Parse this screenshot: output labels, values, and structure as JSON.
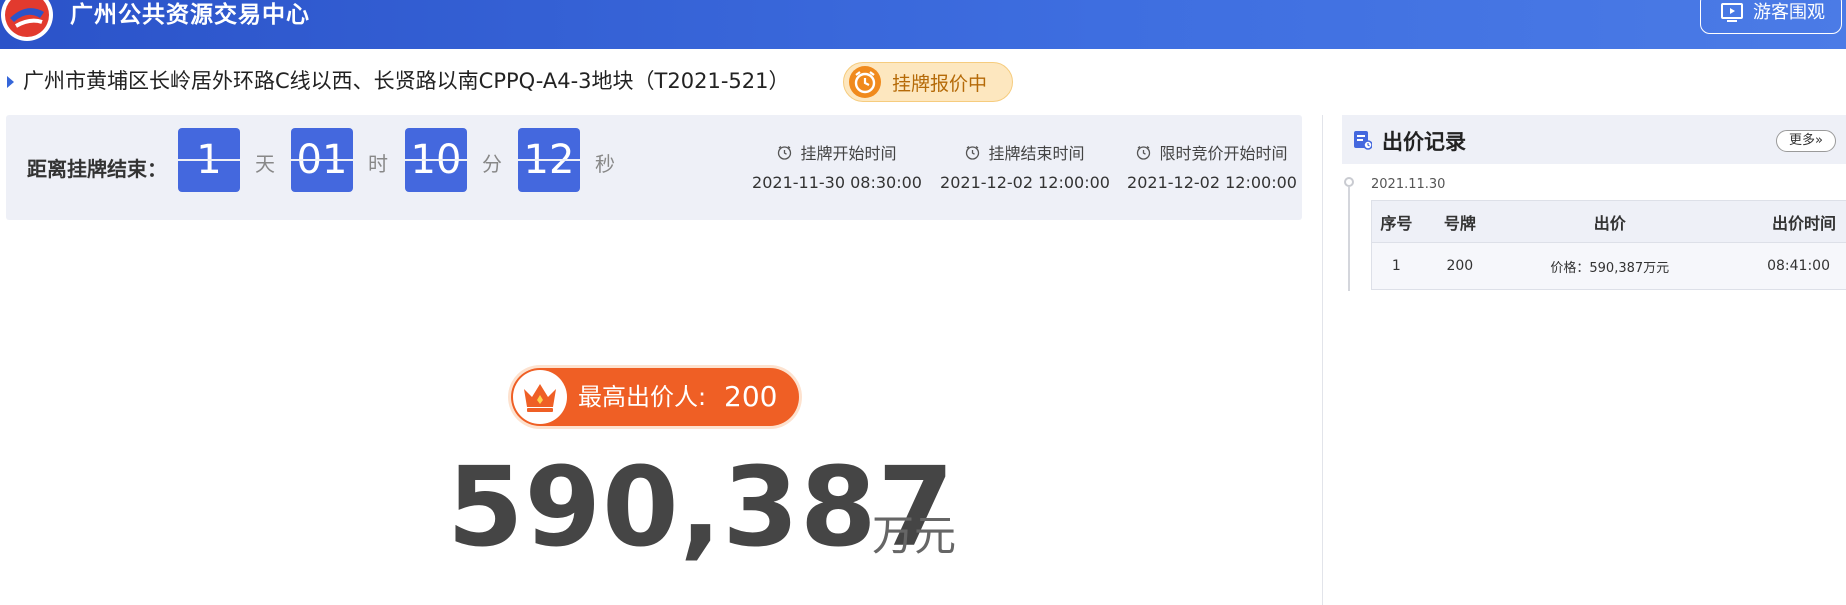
{
  "header": {
    "site_title": "广州公共资源交易中心",
    "guest_button": "游客围观"
  },
  "plot": {
    "title": "广州市黄埔区长岭居外环路C线以西、长贤路以南CPPQ-A4-3地块（T2021-521）",
    "status": "挂牌报价中"
  },
  "countdown": {
    "label": "距离挂牌结束：",
    "days": "1",
    "days_unit": "天",
    "hours": "01",
    "hours_unit": "时",
    "minutes": "10",
    "minutes_unit": "分",
    "seconds": "12",
    "seconds_unit": "秒"
  },
  "times": [
    {
      "label": "挂牌开始时间",
      "value": "2021-11-30 08:30:00"
    },
    {
      "label": "挂牌结束时间",
      "value": "2021-12-02 12:00:00"
    },
    {
      "label": "限时竞价开始时间",
      "value": "2021-12-02 12:00:00"
    }
  ],
  "highest": {
    "label": "最高出价人:",
    "bidder": "200",
    "price": "590,387",
    "unit": "万元"
  },
  "records": {
    "title": "出价记录",
    "more": "更多»",
    "date": "2021.11.30",
    "columns": [
      "序号",
      "号牌",
      "出价",
      "出价时间"
    ],
    "rows": [
      [
        "1",
        "200",
        "价格：590,387万元",
        "08:41:00"
      ]
    ]
  },
  "colors": {
    "header_blue": "#3e6ee0",
    "flip_blue": "#4468de",
    "badge_orange": "#ef5f25",
    "status_bg": "#fde7bf"
  }
}
